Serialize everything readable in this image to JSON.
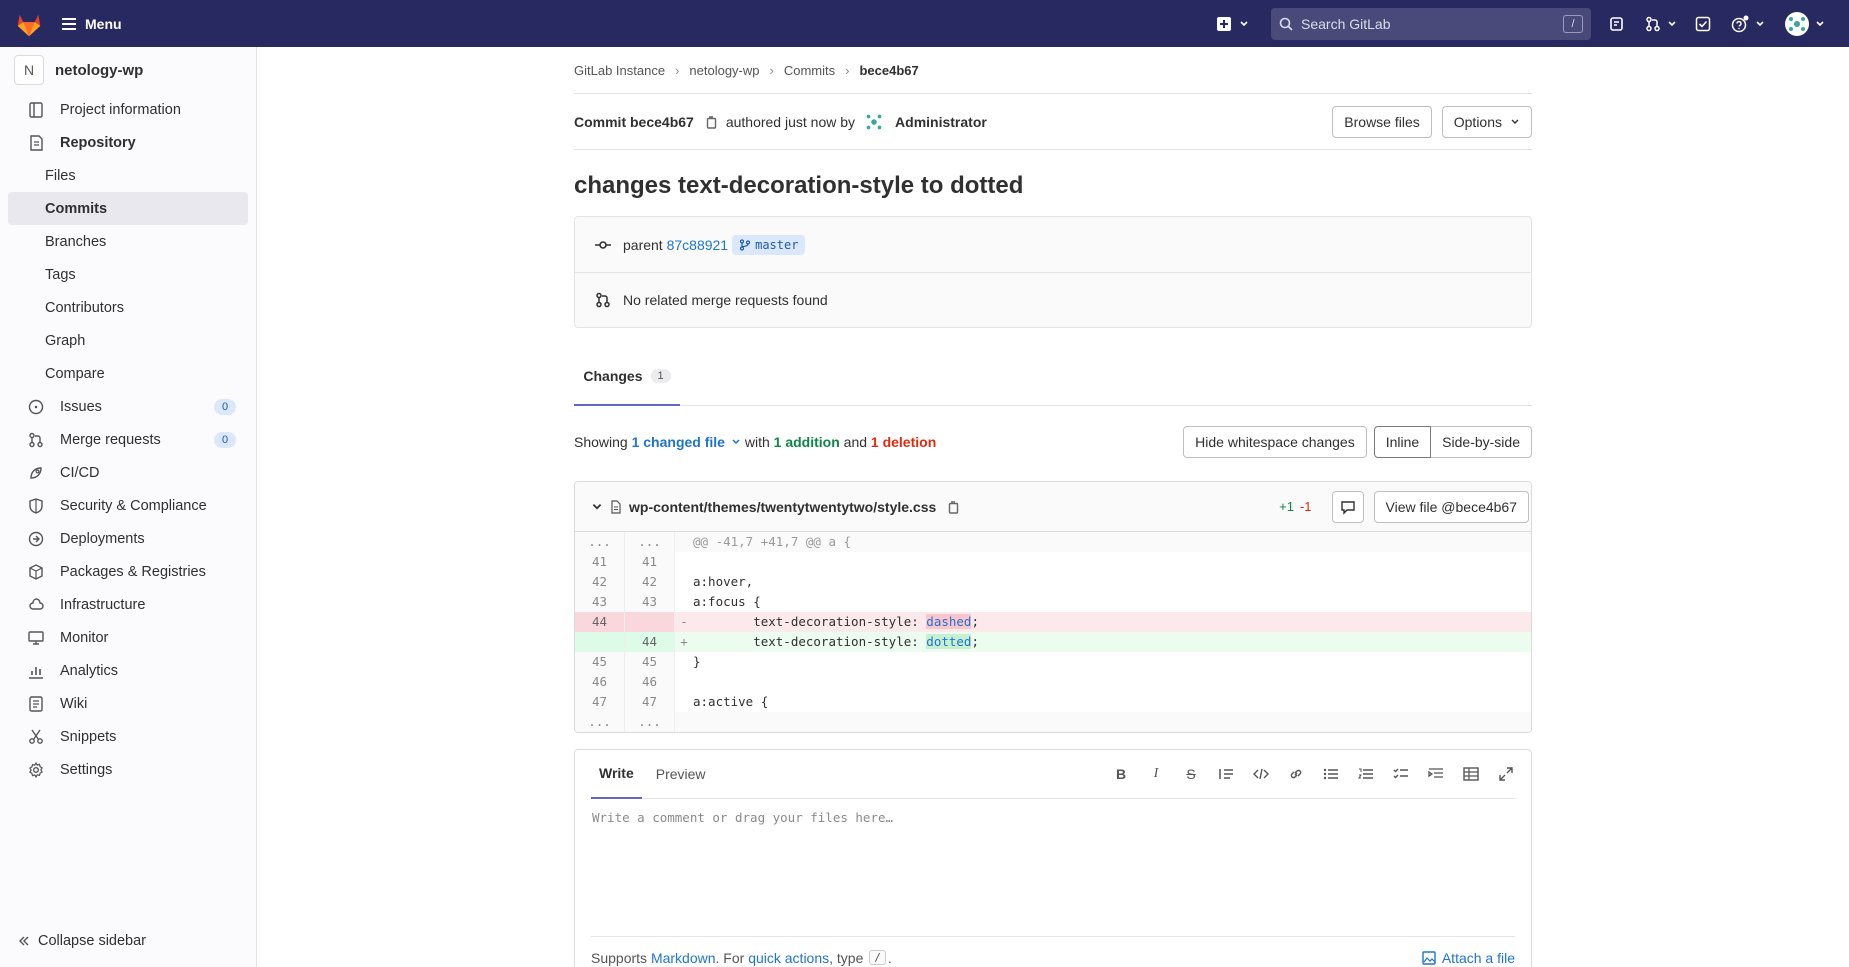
{
  "topbar": {
    "menu_label": "Menu",
    "search_placeholder": "Search GitLab",
    "search_shortcut": "/"
  },
  "sidebar": {
    "project_initial": "N",
    "project_name": "netology-wp",
    "items": [
      {
        "label": "Project information",
        "icon": "info-icon"
      },
      {
        "label": "Repository",
        "icon": "book-icon"
      },
      {
        "label": "Files"
      },
      {
        "label": "Commits"
      },
      {
        "label": "Branches"
      },
      {
        "label": "Tags"
      },
      {
        "label": "Contributors"
      },
      {
        "label": "Graph"
      },
      {
        "label": "Compare"
      },
      {
        "label": "Issues",
        "icon": "issues-icon",
        "count": "0"
      },
      {
        "label": "Merge requests",
        "icon": "merge-request-icon",
        "count": "0"
      },
      {
        "label": "CI/CD",
        "icon": "rocket-icon"
      },
      {
        "label": "Security & Compliance",
        "icon": "shield-icon"
      },
      {
        "label": "Deployments",
        "icon": "deployments-icon"
      },
      {
        "label": "Packages & Registries",
        "icon": "package-icon"
      },
      {
        "label": "Infrastructure",
        "icon": "cloud-icon"
      },
      {
        "label": "Monitor",
        "icon": "monitor-icon"
      },
      {
        "label": "Analytics",
        "icon": "chart-icon"
      },
      {
        "label": "Wiki",
        "icon": "wiki-icon"
      },
      {
        "label": "Snippets",
        "icon": "snippet-icon"
      },
      {
        "label": "Settings",
        "icon": "settings-icon"
      }
    ],
    "collapse_label": "Collapse sidebar"
  },
  "breadcrumb": [
    "GitLab Instance",
    "netology-wp",
    "Commits",
    "bece4b67"
  ],
  "commit": {
    "label": "Commit bece4b67",
    "authored_text": "authored just now by",
    "author": "Administrator",
    "browse_files": "Browse files",
    "options": "Options",
    "title": "changes text-decoration-style to dotted",
    "parent_label": "parent",
    "parent_sha": "87c88921",
    "branch": "master",
    "mr_text": "No related merge requests found"
  },
  "changes": {
    "tab_label": "Changes",
    "tab_count": "1",
    "showing": "Showing",
    "changed_file": "1 changed file",
    "with": "with",
    "addition": "1 addition",
    "and": "and",
    "deletion": "1 deletion",
    "hide_whitespace": "Hide whitespace changes",
    "inline": "Inline",
    "side_by_side": "Side-by-side"
  },
  "file": {
    "path": "wp-content/themes/twentytwentytwo/style.css",
    "plus": "+1",
    "minus": "-1",
    "view_file": "View file @bece4b67",
    "lines": [
      {
        "type": "hunk",
        "n1": "...",
        "n2": "...",
        "sign": "",
        "code": "@@ -41,7 +41,7 @@ a {"
      },
      {
        "type": "ctx",
        "n1": "41",
        "n2": "41",
        "sign": "",
        "code": ""
      },
      {
        "type": "ctx",
        "n1": "42",
        "n2": "42",
        "sign": "",
        "code": "a:hover,"
      },
      {
        "type": "ctx",
        "n1": "43",
        "n2": "43",
        "sign": "",
        "code": "a:focus {"
      },
      {
        "type": "del",
        "n1": "44",
        "n2": "",
        "sign": "-",
        "code": "        text-decoration-style: ",
        "word": "dashed",
        "tail": ";"
      },
      {
        "type": "add",
        "n1": "",
        "n2": "44",
        "sign": "+",
        "code": "        text-decoration-style: ",
        "word": "dotted",
        "tail": ";"
      },
      {
        "type": "ctx",
        "n1": "45",
        "n2": "45",
        "sign": "",
        "code": "}"
      },
      {
        "type": "ctx",
        "n1": "46",
        "n2": "46",
        "sign": "",
        "code": ""
      },
      {
        "type": "ctx",
        "n1": "47",
        "n2": "47",
        "sign": "",
        "code": "a:active {"
      },
      {
        "type": "hunk",
        "n1": "...",
        "n2": "...",
        "sign": "",
        "code": ""
      }
    ]
  },
  "comment": {
    "write_tab": "Write",
    "preview_tab": "Preview",
    "placeholder": "Write a comment or drag your files here…",
    "supports": "Supports",
    "markdown": "Markdown",
    "for": ". For",
    "quick_actions": "quick actions",
    "type": ", type",
    "slash": "/",
    "period": ".",
    "attach": "Attach a file"
  }
}
